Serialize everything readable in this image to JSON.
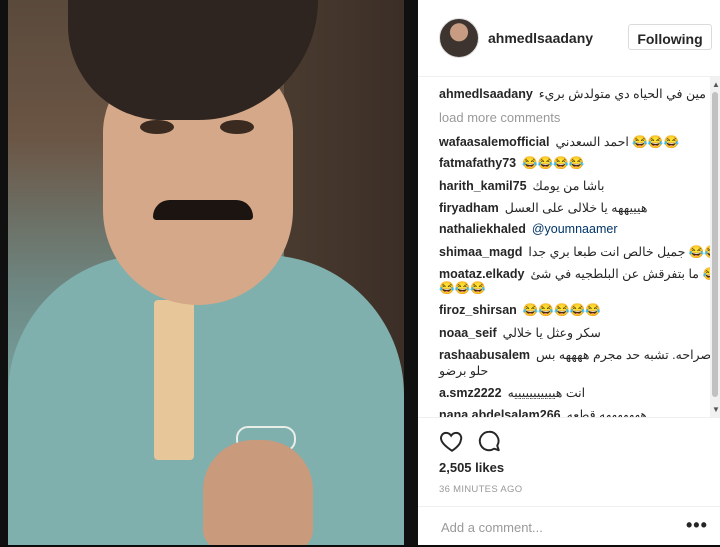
{
  "post": {
    "username": "ahmedlsaadany",
    "follow_label": "Following",
    "caption_user": "ahmedlsaadany",
    "caption_text": "مين في الحياه دي متولدش بريء 😇",
    "load_more": "load more comments",
    "comments": [
      {
        "user": "wafaasalemofficial",
        "text": "احمد السعدني 😂😂😂"
      },
      {
        "user": "fatmafathy73",
        "text": "😂😂😂😂"
      },
      {
        "user": "harith_kamil75",
        "text": "باشا من يومك"
      },
      {
        "user": "firyadham",
        "text": "هيييههه يا خلالى على العسل"
      },
      {
        "user": "nathaliekhaled",
        "text": "@youmnaamer"
      },
      {
        "user": "shimaa_magd",
        "text": "جميل خالص انت طبعا بري جدا 😂😂"
      },
      {
        "user": "moataz.elkady",
        "text": "ما بتفرقش عن البلطجيه في شئ 😂"
      },
      {
        "user": "",
        "text": "😂😂😂"
      },
      {
        "user": "firoz_shirsan",
        "text": "😂😂😂😂😂"
      },
      {
        "user": "noaa_seif",
        "text": "سكر وعثل يا خلالي"
      },
      {
        "user": "rashaabusalem",
        "text": "صراحه. تشبه حد مجرم ههههه بس"
      },
      {
        "user": "",
        "text": "حلو برضو"
      },
      {
        "user": "a.smz2222",
        "text": "انت هيييييييييييه"
      },
      {
        "user": "nana.abdelsalam266",
        "text": "هههههههه قطعه"
      }
    ],
    "likes": "2,505 likes",
    "time": "36 MINUTES AGO",
    "add_comment_placeholder": "Add a comment...",
    "more_label": "•••"
  },
  "icons": {
    "heart": "heart-icon",
    "comment": "comment-icon",
    "more": "more-options-icon"
  },
  "colors": {
    "text": "#262626",
    "muted": "#999999",
    "mention": "#003569",
    "border": "#dbdbdb"
  }
}
